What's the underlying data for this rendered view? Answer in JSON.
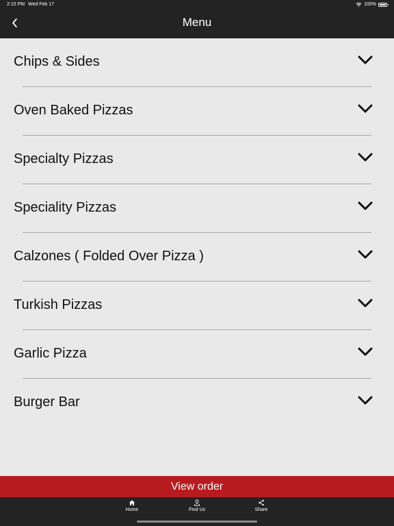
{
  "status": {
    "time": "2:15 PM",
    "date": "Wed Feb 17",
    "battery": "100%"
  },
  "header": {
    "title": "Menu"
  },
  "menu": {
    "items": [
      {
        "label": "Chips & Sides"
      },
      {
        "label": "Oven Baked Pizzas"
      },
      {
        "label": "Specialty Pizzas"
      },
      {
        "label": "Speciality Pizzas"
      },
      {
        "label": "Calzones ( Folded Over Pizza )"
      },
      {
        "label": "Turkish Pizzas"
      },
      {
        "label": "Garlic Pizza"
      },
      {
        "label": "Burger Bar"
      }
    ]
  },
  "order": {
    "button_label": "View order"
  },
  "tabs": [
    {
      "label": "Home",
      "icon": "home-icon"
    },
    {
      "label": "Find Us",
      "icon": "location-icon"
    },
    {
      "label": "Share",
      "icon": "share-icon"
    }
  ],
  "colors": {
    "bar_background": "#232323",
    "accent": "#b71b1f",
    "page_background": "#e9e9e9"
  }
}
